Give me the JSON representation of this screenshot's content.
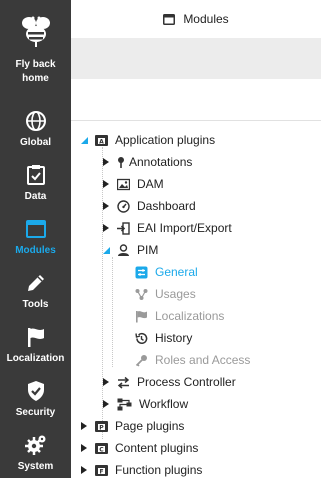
{
  "sidebar": {
    "home_label": "Fly back home",
    "items": [
      {
        "label": "Global",
        "icon": "globe-icon"
      },
      {
        "label": "Data",
        "icon": "clipboard-check-icon"
      },
      {
        "label": "Modules",
        "icon": "window-icon",
        "active": true
      },
      {
        "label": "Tools",
        "icon": "pencil-icon"
      },
      {
        "label": "Localization",
        "icon": "flag-icon"
      },
      {
        "label": "Security",
        "icon": "shield-check-icon"
      },
      {
        "label": "System",
        "icon": "gears-icon"
      }
    ],
    "active_color": "#1ba9ea",
    "background": "#3a3a3a"
  },
  "header": {
    "title": "Modules",
    "icon": "window-icon"
  },
  "tree": {
    "application_plugins": "Application plugins",
    "annotations": "Annotations",
    "dam": "DAM",
    "dashboard": "Dashboard",
    "eai": "EAI Import/Export",
    "pim": "PIM",
    "general": "General",
    "usages": "Usages",
    "localizations": "Localizations",
    "history": "History",
    "roles": "Roles and Access",
    "process_controller": "Process Controller",
    "workflow": "Workflow",
    "page_plugins": "Page plugins",
    "content_plugins": "Content plugins",
    "function_plugins": "Function plugins"
  }
}
